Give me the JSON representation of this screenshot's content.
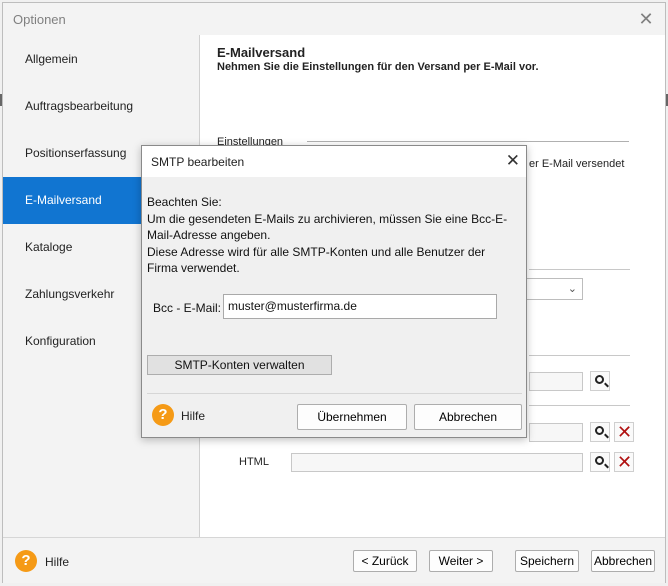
{
  "window": {
    "title": "Optionen"
  },
  "sidebar": {
    "items": [
      {
        "label": "Allgemein",
        "active": false
      },
      {
        "label": "Auftragsbearbeitung",
        "active": false
      },
      {
        "label": "Positionserfassung",
        "active": false
      },
      {
        "label": "E-Mailversand",
        "active": true
      },
      {
        "label": "Kataloge",
        "active": false
      },
      {
        "label": "Zahlungsverkehr",
        "active": false
      },
      {
        "label": "Konfiguration",
        "active": false
      }
    ]
  },
  "content": {
    "heading": "E-Mailversand",
    "subheading": "Nehmen Sie die Einstellungen für den Versand per E-Mail vor.",
    "group_label": "Einstellungen",
    "partial_text": "er E-Mail versendet",
    "html_label": "HTML"
  },
  "footer": {
    "help_label": "Hilfe",
    "back_label": "< Zurück",
    "next_label": "Weiter >",
    "save_label": "Speichern",
    "cancel_label": "Abbrechen"
  },
  "dialog": {
    "title": "SMTP bearbeiten",
    "note_heading": "Beachten Sie:",
    "note_line1": "Um die gesendeten E-Mails zu archivieren, müssen Sie eine Bcc-E-Mail-Adresse angeben.",
    "note_line2": "Diese Adresse wird für alle SMTP-Konten und alle Benutzer der Firma verwendet.",
    "bcc_label": "Bcc - E-Mail:",
    "bcc_value": "muster@musterfirma.de",
    "manage_button": "SMTP-Konten verwalten",
    "help_label": "Hilfe",
    "apply_button": "Übernehmen",
    "cancel_button": "Abbrechen"
  },
  "colors": {
    "accent": "#1175d1",
    "help_icon": "#f59a16",
    "delete_icon": "#b01010"
  }
}
